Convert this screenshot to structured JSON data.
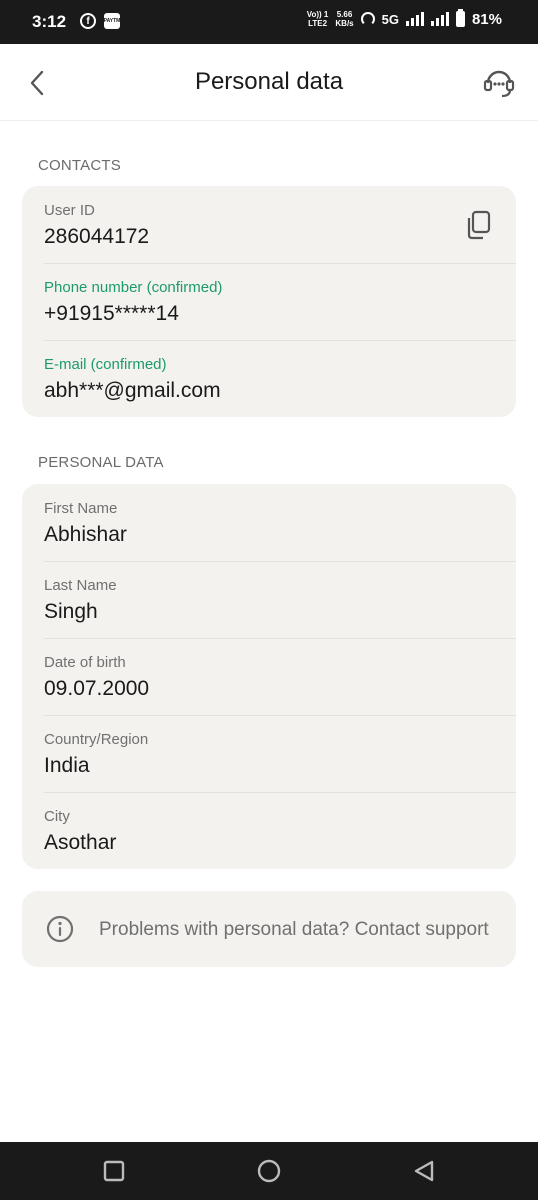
{
  "status_bar": {
    "time": "3:12",
    "network_top": "Vo)) 1",
    "network_bottom": "LTE2",
    "speed_top": "5.66",
    "speed_bottom": "KB/s",
    "network_type": "5G",
    "battery": "81%"
  },
  "header": {
    "title": "Personal data",
    "back_icon": "chevron-left-icon",
    "support_icon": "headset-icon"
  },
  "contacts": {
    "section_label": "CONTACTS",
    "user_id": {
      "label": "User ID",
      "value": "286044172"
    },
    "phone": {
      "label": "Phone number (confirmed)",
      "value": "+91915*****14"
    },
    "email": {
      "label": "E-mail (confirmed)",
      "value": "abh***@gmail.com"
    }
  },
  "personal": {
    "section_label": "PERSONAL DATA",
    "first_name": {
      "label": "First Name",
      "value": "Abhishar"
    },
    "last_name": {
      "label": "Last Name",
      "value": "Singh"
    },
    "dob": {
      "label": "Date of birth",
      "value": "09.07.2000"
    },
    "country": {
      "label": "Country/Region",
      "value": "India"
    },
    "city": {
      "label": "City",
      "value": "Asothar"
    }
  },
  "help": {
    "text": "Problems with personal data? Contact support"
  },
  "colors": {
    "confirmed_green": "#1d9b6a",
    "card_bg": "#f3f2ef",
    "label_gray": "#707070"
  }
}
